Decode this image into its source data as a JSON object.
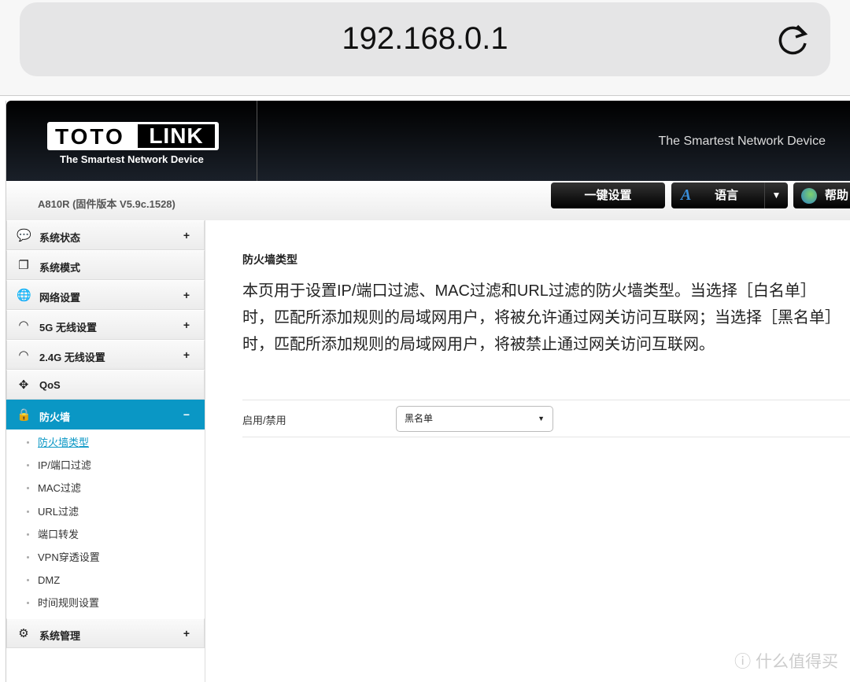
{
  "browser": {
    "url": "192.168.0.1"
  },
  "header": {
    "logo_left": "TOTO",
    "logo_right": "LINK",
    "tagline": "The Smartest Network Device",
    "slogan": "The Smartest Network Device",
    "model": "A810R (固件版本 V5.9c.1528)"
  },
  "toolbar": {
    "quick_setup": "一键设置",
    "language": "语言",
    "help": "帮助"
  },
  "sidebar": {
    "items": [
      {
        "label": "系统状态",
        "icon": "chat-icon",
        "expand": "+"
      },
      {
        "label": "系统模式",
        "icon": "windows-icon",
        "expand": ""
      },
      {
        "label": "网络设置",
        "icon": "globe-icon",
        "expand": "+"
      },
      {
        "label": "5G 无线设置",
        "icon": "wifi-icon",
        "expand": "+"
      },
      {
        "label": "2.4G 无线设置",
        "icon": "wifi-icon",
        "expand": "+"
      },
      {
        "label": "QoS",
        "icon": "qos-icon",
        "expand": ""
      },
      {
        "label": "防火墙",
        "icon": "lock-icon",
        "expand": "−"
      },
      {
        "label": "系统管理",
        "icon": "gear-icon",
        "expand": "+"
      }
    ],
    "firewall_sub": [
      "防火墙类型",
      "IP/端口过滤",
      "MAC过滤",
      "URL过滤",
      "端口转发",
      "VPN穿透设置",
      "DMZ",
      "时间规则设置"
    ]
  },
  "main": {
    "title": "防火墙类型",
    "description": "本页用于设置IP/端口过滤、MAC过滤和URL过滤的防火墙类型。当选择［白名单］时，匹配所添加规则的局域网用户，将被允许通过网关访问互联网；当选择［黑名单］时，匹配所添加规则的局域网用户，将被禁止通过网关访问互联网。",
    "field_label": "启用/禁用",
    "field_value": "黑名单"
  },
  "colors": {
    "accent": "#0a97c5"
  },
  "watermark": "值 什么值得买"
}
